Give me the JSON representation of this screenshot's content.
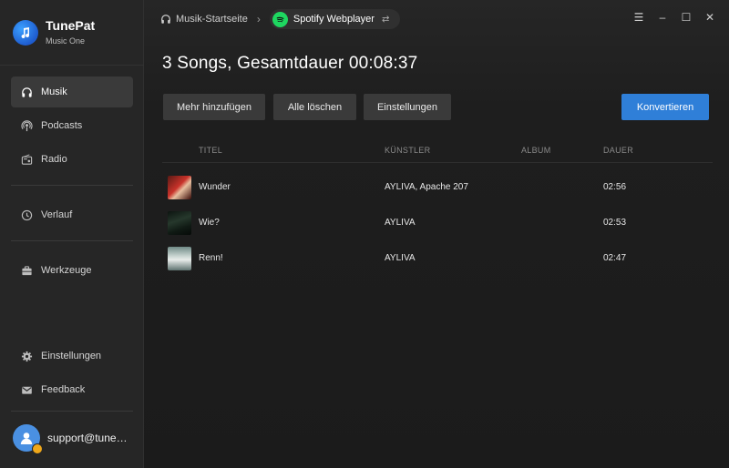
{
  "app": {
    "name": "TunePat",
    "subtitle": "Music One"
  },
  "sidebar": {
    "items": [
      {
        "label": "Musik",
        "icon": "headphones-icon"
      },
      {
        "label": "Podcasts",
        "icon": "podcast-icon"
      },
      {
        "label": "Radio",
        "icon": "radio-icon"
      },
      {
        "label": "Verlauf",
        "icon": "clock-icon"
      },
      {
        "label": "Werkzeuge",
        "icon": "toolbox-icon"
      },
      {
        "label": "Einstellungen",
        "icon": "gear-icon"
      },
      {
        "label": "Feedback",
        "icon": "mail-icon"
      }
    ],
    "user": "support@tunepa..."
  },
  "topbar": {
    "breadcrumb": "Musik-Startseite",
    "source": "Spotify Webplayer"
  },
  "main": {
    "heading": "3 Songs, Gesamtdauer 00:08:37",
    "buttons": {
      "add": "Mehr hinzufügen",
      "clear": "Alle löschen",
      "settings": "Einstellungen",
      "convert": "Konvertieren"
    },
    "columns": {
      "title": "TITEL",
      "artist": "KÜNSTLER",
      "album": "ALBUM",
      "duration": "DAUER"
    },
    "rows": [
      {
        "title": "Wunder",
        "artist": "AYLIVA, Apache 207",
        "album": "",
        "duration": "02:56"
      },
      {
        "title": "Wie?",
        "artist": "AYLIVA",
        "album": "",
        "duration": "02:53"
      },
      {
        "title": "Renn!",
        "artist": "AYLIVA",
        "album": "",
        "duration": "02:47"
      }
    ]
  },
  "colors": {
    "accent": "#2f7fd8",
    "spotify": "#1ed760"
  }
}
